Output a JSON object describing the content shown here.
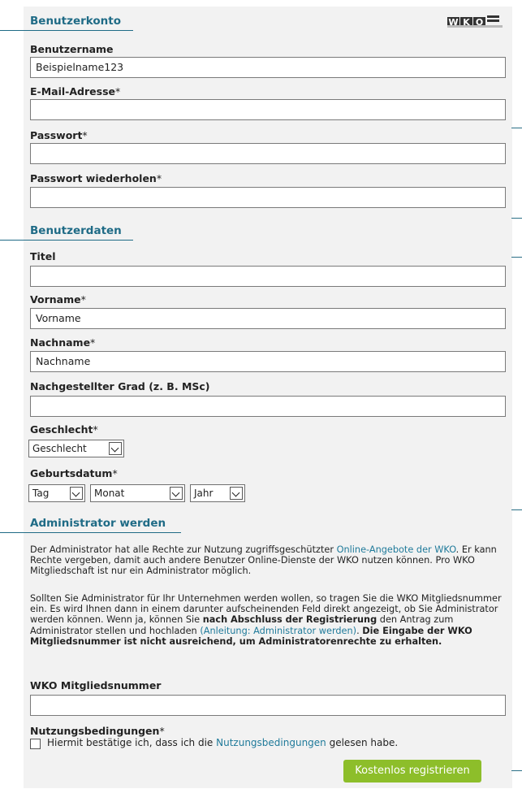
{
  "logo": {
    "letters": [
      "W",
      "K",
      "O"
    ]
  },
  "sections": {
    "account": "Benutzerkonto",
    "userdata": "Benutzerdaten",
    "admin": "Administrator werden"
  },
  "fields": {
    "username": {
      "label": "Benutzername",
      "value": "Beispielname123"
    },
    "email": {
      "label": "E-Mail-Adresse",
      "required": "*",
      "value": ""
    },
    "password": {
      "label": "Passwort",
      "required": "*",
      "value": ""
    },
    "password_repeat": {
      "label": "Passwort wiederholen",
      "required": "*",
      "value": ""
    },
    "title": {
      "label": "Titel",
      "value": ""
    },
    "firstname": {
      "label": "Vorname",
      "required": "*",
      "value": "Vorname"
    },
    "lastname": {
      "label": "Nachname",
      "required": "*",
      "value": "Nachname"
    },
    "grade": {
      "label": "Nachgestellter Grad (z. B. MSc)",
      "value": ""
    },
    "gender": {
      "label": "Geschlecht",
      "required": "*",
      "value": "Geschlecht"
    },
    "birthdate": {
      "label": "Geburtsdatum",
      "required": "*",
      "day": "Tag",
      "month": "Monat",
      "year": "Jahr"
    },
    "member_number": {
      "label": "WKO Mitgliedsnummer",
      "value": ""
    },
    "terms": {
      "label": "Nutzungsbedingungen",
      "required": "*"
    }
  },
  "admin_text": {
    "p1_a": "Der Administrator hat alle Rechte zur Nutzung zugriffsgeschützter ",
    "p1_link": "Online-Angebote der WKO",
    "p1_b": ". Er kann Rechte vergeben, damit auch andere Benutzer Online-Dienste der WKO nutzen können. Pro WKO Mitgliedschaft ist nur ein Administrator möglich.",
    "p2_a": "Sollten Sie Administrator für Ihr Unternehmen werden wollen, so tragen Sie die WKO Mitgliedsnummer ein. Es wird Ihnen dann in einem darunter aufscheinenden Feld direkt angezeigt, ob Sie Administrator werden können. Wenn ja, können Sie ",
    "p2_bold1": "nach Abschluss der Registrierung",
    "p2_b": " den Antrag zum Administrator stellen und hochladen ",
    "p2_link": "(Anleitung: Administrator werden)",
    "p2_c": ". ",
    "p2_bold2": "Die Eingabe der WKO Mitgliedsnummer ist nicht ausreichend, um Administratorenrechte zu erhalten."
  },
  "terms_text": {
    "a": "Hiermit bestätige ich, dass ich die ",
    "link": "Nutzungsbedingungen",
    "b": " gelesen habe."
  },
  "submit_label": "Kostenlos registrieren",
  "colors": {
    "accent": "#1f6b86",
    "button": "#8dbe2a",
    "link": "#1f7a9a"
  }
}
